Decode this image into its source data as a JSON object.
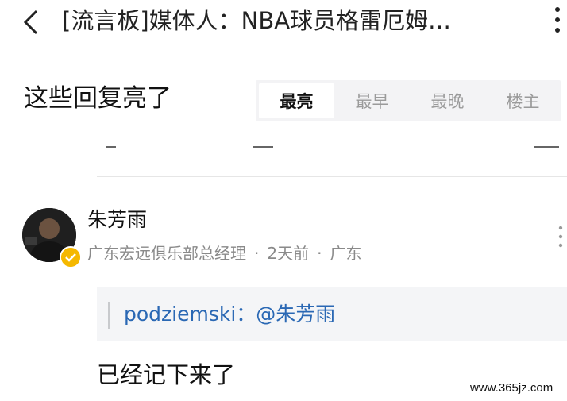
{
  "header": {
    "title": "[流言板]媒体人：NBA球员格雷厄姆…"
  },
  "replies": {
    "section_title": "这些回复亮了",
    "sort_tabs": [
      {
        "label": "最亮",
        "active": true
      },
      {
        "label": "最早",
        "active": false
      },
      {
        "label": "最晚",
        "active": false
      },
      {
        "label": "楼主",
        "active": false
      }
    ]
  },
  "comment": {
    "author": "朱芳雨",
    "role": "广东宏远俱乐部总经理",
    "time": "2天前",
    "location": "广东",
    "separator": "·",
    "quote_text": "podziemski：@朱芳雨",
    "body": "已经记下来了",
    "verified_color": "#f5b800"
  },
  "watermark": "www.365jz.com",
  "colors": {
    "link": "#2a68b4",
    "muted": "#8a8a8a",
    "segment_bg": "#f3f3f5"
  }
}
